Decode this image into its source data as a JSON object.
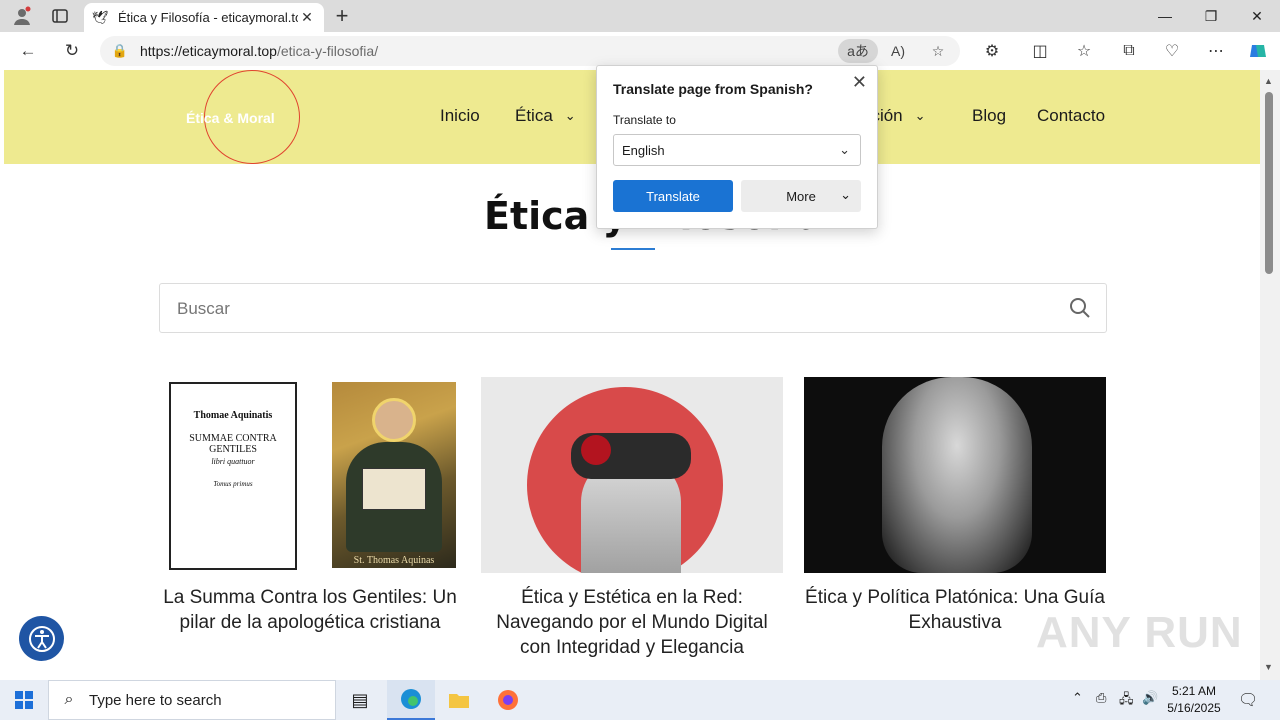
{
  "browser": {
    "tab_title": "Ética y Filosofía - eticaymoral.top",
    "url_host": "https://eticaymoral.top",
    "url_path": "/etica-y-filosofia/",
    "translate_icon": "aあ",
    "read_aloud_icon": "A)"
  },
  "site": {
    "logo": "Ética & Moral",
    "menu": [
      {
        "label": "Inicio"
      },
      {
        "label": "Ética"
      },
      {
        "label": "ación"
      },
      {
        "label": "Blog"
      },
      {
        "label": "Contacto"
      }
    ],
    "page_title": "Ética y Filosofía",
    "search_placeholder": "Buscar",
    "cards": [
      {
        "caption": "La Summa Contra los Gentiles: Un pilar de la apologética cristiana",
        "book_title": "Thomae Aquinatis",
        "book_sub": "SUMMAE CONTRA GENTILES",
        "book_sub2": "libri quattuor",
        "book_vol": "Tomus primus",
        "saint_label": "St. Thomas Aquinas"
      },
      {
        "caption": "Ética y Estética en la Red: Navegando por el Mundo Digital con Integridad y Elegancia"
      },
      {
        "caption": "Ética y Política Platónica: Una Guía Exhaustiva"
      }
    ]
  },
  "translate_popup": {
    "title": "Translate page from Spanish?",
    "label": "Translate to",
    "language": "English",
    "translate_button": "Translate",
    "more_button": "More"
  },
  "watermark": "ANY RUN",
  "taskbar": {
    "search_placeholder": "Type here to search",
    "time": "5:21 AM",
    "date": "5/16/2025"
  },
  "colors": {
    "header_bg": "#eeea90",
    "accent_blue": "#1a73d3",
    "logo_ring": "#e0432f",
    "a11y_button": "#1f55a4"
  }
}
